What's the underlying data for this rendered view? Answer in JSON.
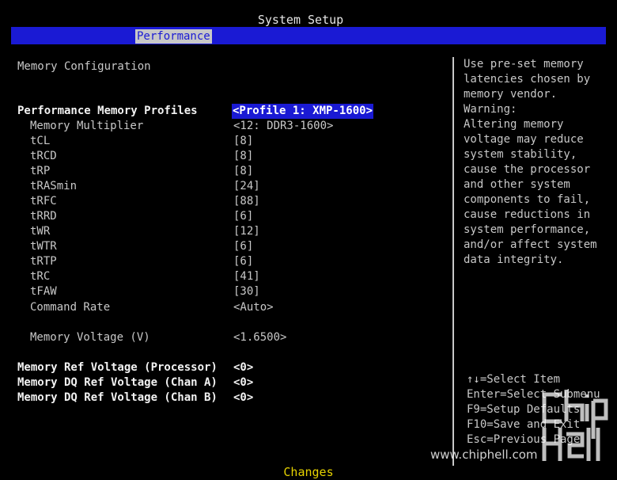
{
  "title": "System Setup",
  "menu": {
    "active_tab": "Performance"
  },
  "section_title": "Memory Configuration",
  "settings": [
    {
      "label": "Performance Memory Profiles",
      "value": "<Profile 1: XMP-1600>"
    },
    {
      "label": "Memory Multiplier",
      "value": "<12: DDR3-1600>"
    },
    {
      "label": "tCL",
      "value": "[8]"
    },
    {
      "label": "tRCD",
      "value": "[8]"
    },
    {
      "label": "tRP",
      "value": "[8]"
    },
    {
      "label": "tRASmin",
      "value": "[24]"
    },
    {
      "label": "tRFC",
      "value": "[88]"
    },
    {
      "label": "tRRD",
      "value": "[6]"
    },
    {
      "label": "tWR",
      "value": "[12]"
    },
    {
      "label": "tWTR",
      "value": "[6]"
    },
    {
      "label": "tRTP",
      "value": "[6]"
    },
    {
      "label": "tRC",
      "value": "[41]"
    },
    {
      "label": "tFAW",
      "value": "[30]"
    },
    {
      "label": "Command Rate",
      "value": "<Auto>"
    },
    {
      "label": "Memory Voltage (V)",
      "value": "<1.6500>"
    },
    {
      "label": "Memory Ref Voltage (Processor)",
      "value": "<0>"
    },
    {
      "label": "Memory DQ Ref Voltage (Chan A)",
      "value": "<0>"
    },
    {
      "label": "Memory DQ Ref Voltage (Chan B)",
      "value": "<0>"
    }
  ],
  "help_text": [
    "Use pre-set memory",
    "latencies chosen by",
    "memory vendor.",
    "Warning:",
    "Altering memory",
    "voltage may reduce",
    "system stability,",
    "cause the processor",
    "and other system",
    "components to fail,",
    "cause reductions in",
    "system performance,",
    "and/or affect system",
    "data integrity."
  ],
  "key_help": [
    "↑↓=Select Item",
    "Enter=Select Submenu",
    "F9=Setup Defaults",
    "F10=Save and Exit",
    "Esc=Previous Page"
  ],
  "watermark": {
    "url": "www.chiphell.com",
    "logo_text": "chip hell"
  },
  "status": "Changes",
  "colors": {
    "background": "#000000",
    "menubar": "#1a1ad4",
    "text": "#c8c8c8",
    "highlight_text": "#f2f2f2",
    "status": "#e6d200"
  }
}
